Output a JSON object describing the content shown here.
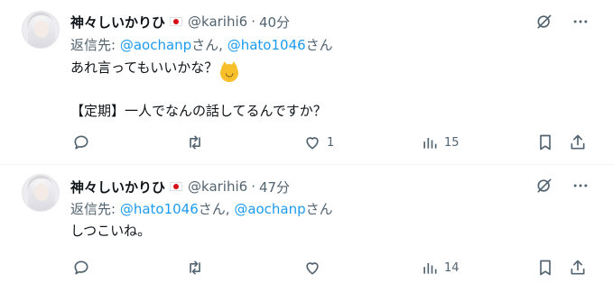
{
  "tweets": [
    {
      "name": "神々しいかりひ",
      "handle": "@karihi6",
      "separator": "·",
      "time": "40分",
      "reply_prefix": "返信先: ",
      "reply_user1": "@aochanp",
      "reply_suffix1": "さん, ",
      "reply_user2": "@hato1046",
      "reply_suffix2": "さん",
      "body_line1": "あれ言ってもいいかな？",
      "body_line2": "【定期】一人でなんの話してるんですか？",
      "like_count": "1",
      "view_count": "15",
      "icons": [
        "grok-icon",
        "more-icon",
        "reply-icon",
        "retweet-icon",
        "like-icon",
        "views-icon",
        "bookmark-icon",
        "share-icon"
      ]
    },
    {
      "name": "神々しいかりひ",
      "handle": "@karihi6",
      "separator": "·",
      "time": "47分",
      "reply_prefix": "返信先: ",
      "reply_user1": "@hato1046",
      "reply_suffix1": "さん, ",
      "reply_user2": "@aochanp",
      "reply_suffix2": "さん",
      "body_line1": "しつこいね。",
      "like_count": "",
      "view_count": "14",
      "icons": [
        "grok-icon",
        "more-icon",
        "reply-icon",
        "retweet-icon",
        "like-icon",
        "views-icon",
        "bookmark-icon",
        "share-icon"
      ]
    }
  ],
  "colors": {
    "text": "#0f1419",
    "muted": "#536471",
    "link": "#1d9bf0",
    "divider": "#eff3f4"
  }
}
